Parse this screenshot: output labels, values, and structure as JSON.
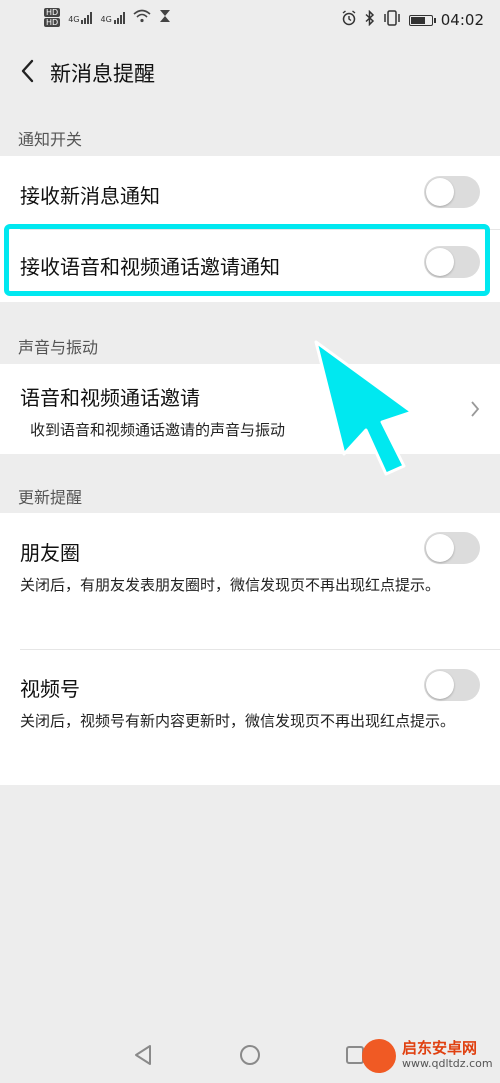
{
  "status_bar": {
    "left_labels": [
      "HD",
      "4G",
      "4G"
    ],
    "right_icons": [
      "alarm-icon",
      "bluetooth-icon",
      "vibrate-icon",
      "battery-icon"
    ],
    "battery_level": 0.8,
    "time": "04:02"
  },
  "header": {
    "title": "新消息提醒"
  },
  "sections": {
    "notify_switch": {
      "label": "通知开关",
      "rows": [
        {
          "title": "接收新消息通知",
          "toggle_on": false
        },
        {
          "title": "接收语音和视频通话邀请通知",
          "toggle_on": false
        }
      ]
    },
    "sound_vibration": {
      "label": "声音与振动",
      "row": {
        "title": "语音和视频通话邀请",
        "desc": "收到语音和视频通话邀请的声音与振动"
      }
    },
    "update_reminder": {
      "label": "更新提醒",
      "rows": [
        {
          "title": "朋友圈",
          "desc": "关闭后，有朋友发表朋友圈时，微信发现页不再出现红点提示。",
          "toggle_on": false
        },
        {
          "title": "视频号",
          "desc": "关闭后，视频号有新内容更新时，微信发现页不再出现红点提示。",
          "toggle_on": false
        }
      ]
    }
  },
  "annotation": {
    "color": "#00e8f0"
  },
  "nav_bar": {
    "buttons": [
      "back-triangle-icon",
      "home-circle-icon",
      "recents-square-icon"
    ]
  },
  "watermark": {
    "name": "启东安卓网",
    "url": "www.qdltdz.com"
  }
}
